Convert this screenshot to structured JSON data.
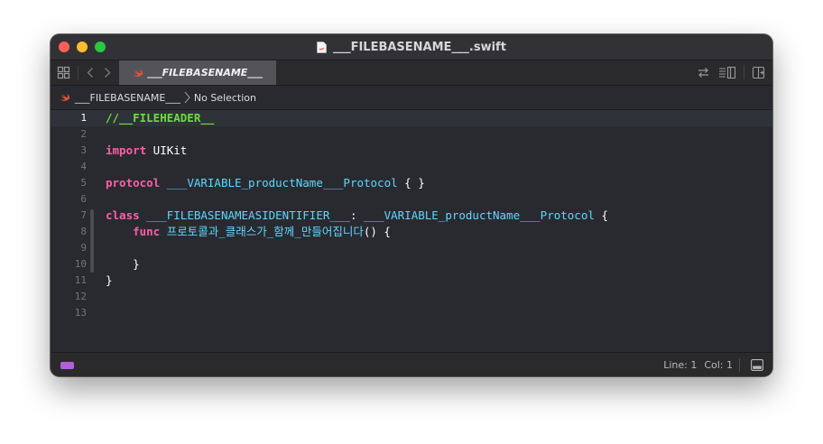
{
  "window": {
    "title": "___FILEBASENAME___.swift"
  },
  "tabs": [
    {
      "label": "___FILEBASENAME___",
      "icon": "swift-icon",
      "active": true
    }
  ],
  "jump_bar": {
    "file": "___FILEBASENAME___",
    "selection": "No Selection"
  },
  "editor": {
    "current_line": 1,
    "lines": [
      {
        "number": "1",
        "tokens": [
          {
            "text": "//__FILEHEADER__",
            "kind": "comment"
          }
        ]
      },
      {
        "number": "2",
        "tokens": []
      },
      {
        "number": "3",
        "tokens": [
          {
            "text": "import",
            "kind": "keyword"
          },
          {
            "text": " UIKit",
            "kind": "plain"
          }
        ]
      },
      {
        "number": "4",
        "tokens": []
      },
      {
        "number": "5",
        "tokens": [
          {
            "text": "protocol",
            "kind": "keyword"
          },
          {
            "text": " ",
            "kind": "plain"
          },
          {
            "text": "___VARIABLE_productName___Protocol",
            "kind": "decl"
          },
          {
            "text": " { }",
            "kind": "plain"
          }
        ]
      },
      {
        "number": "6",
        "tokens": []
      },
      {
        "number": "7",
        "tokens": [
          {
            "text": "class",
            "kind": "keyword"
          },
          {
            "text": " ",
            "kind": "plain"
          },
          {
            "text": "___FILEBASENAMEASIDENTIFIER___",
            "kind": "decl"
          },
          {
            "text": ": ",
            "kind": "plain"
          },
          {
            "text": "___VARIABLE_productName___Protocol",
            "kind": "decl"
          },
          {
            "text": " {",
            "kind": "plain"
          }
        ]
      },
      {
        "number": "8",
        "tokens": [
          {
            "text": "    ",
            "kind": "plain"
          },
          {
            "text": "func",
            "kind": "keyword"
          },
          {
            "text": " ",
            "kind": "plain"
          },
          {
            "text": "프로토콜과_클래스가_함께_만들어집니다",
            "kind": "decl"
          },
          {
            "text": "() {",
            "kind": "plain"
          }
        ]
      },
      {
        "number": "9",
        "tokens": []
      },
      {
        "number": "10",
        "tokens": [
          {
            "text": "    }",
            "kind": "plain"
          }
        ]
      },
      {
        "number": "11",
        "tokens": [
          {
            "text": "}",
            "kind": "plain"
          }
        ]
      },
      {
        "number": "12",
        "tokens": []
      },
      {
        "number": "13",
        "tokens": []
      }
    ]
  },
  "status": {
    "line": "Line: 1",
    "col": "Col: 1"
  },
  "colors": {
    "keyword": "#fc5fa3",
    "declaration": "#5dd8ff",
    "comment": "#6bdf38",
    "background": "#292a30"
  }
}
